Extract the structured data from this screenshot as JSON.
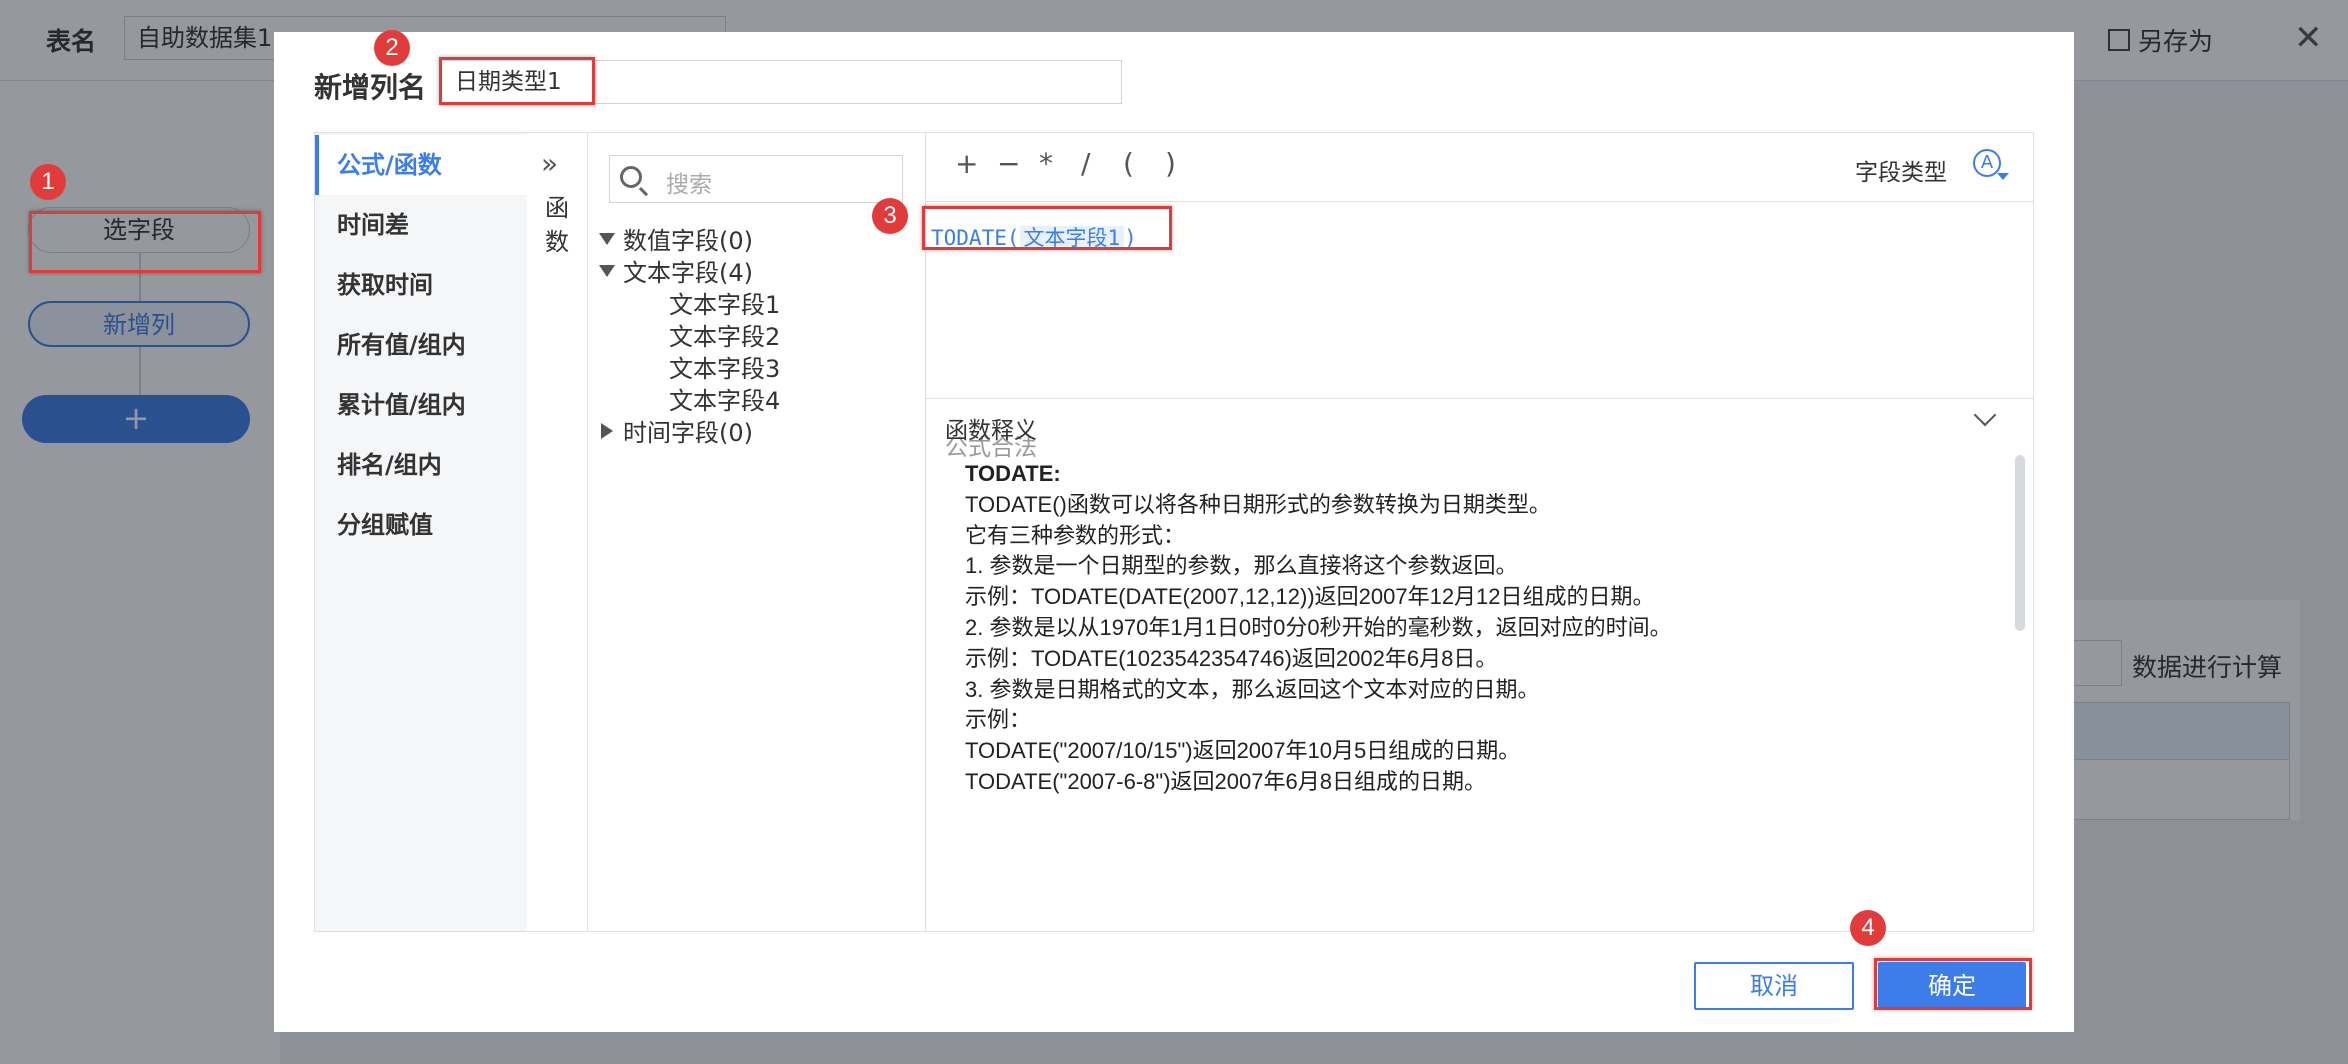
{
  "background": {
    "table_name_label": "表名",
    "table_name_value": "自助数据集1",
    "save_as_label": "另存为",
    "steps": [
      "选字段",
      "新增列"
    ],
    "add_step_label": "+",
    "calc_label": "数据进行计算"
  },
  "dialog": {
    "title": "新增列名",
    "column_name_value": "日期类型1",
    "categories": [
      {
        "label": "公式/函数",
        "active": true
      },
      {
        "label": "时间差"
      },
      {
        "label": "获取时间"
      },
      {
        "label": "所有值/组内"
      },
      {
        "label": "累计值/组内"
      },
      {
        "label": "排名/组内"
      },
      {
        "label": "分组赋值"
      }
    ],
    "function_panel": {
      "expand_icon": "»",
      "label": "函数"
    },
    "search": {
      "placeholder": "搜索"
    },
    "field_tree": [
      {
        "label": "数值字段(0)",
        "expanded": true,
        "children": []
      },
      {
        "label": "文本字段(4)",
        "expanded": true,
        "children": [
          "文本字段1",
          "文本字段2",
          "文本字段3",
          "文本字段4"
        ]
      },
      {
        "label": "时间字段(0)",
        "expanded": false,
        "children": []
      }
    ],
    "operators": [
      "+",
      "−",
      "*",
      "/",
      "(",
      ")"
    ],
    "field_type_label": "字段类型",
    "field_type_icon": "A",
    "formula": {
      "func": "TODATE(",
      "field": "文本字段1",
      "close": ")"
    },
    "validation_message": "公式合法",
    "explain_title": "函数释义",
    "explain_lines": [
      "TODATE:",
      "TODATE()函数可以将各种日期形式的参数转换为日期类型。",
      "它有三种参数的形式：",
      "1. 参数是一个日期型的参数，那么直接将这个参数返回。",
      "示例：TODATE(DATE(2007,12,12))返回2007年12月12日组成的日期。",
      "2. 参数是以从1970年1月1日0时0分0秒开始的毫秒数，返回对应的时间。",
      "示例：TODATE(1023542354746)返回2002年6月8日。",
      "3. 参数是日期格式的文本，那么返回这个文本对应的日期。",
      "示例：",
      "TODATE(\"2007/10/15\")返回2007年10月5日组成的日期。",
      "TODATE(\"2007-6-8\")返回2007年6月8日组成的日期。"
    ],
    "cancel_label": "取消",
    "ok_label": "确定"
  },
  "annotations": [
    "1",
    "2",
    "3",
    "4"
  ],
  "colors": {
    "accent": "#3c7de9",
    "highlight": "#e03a3a"
  }
}
